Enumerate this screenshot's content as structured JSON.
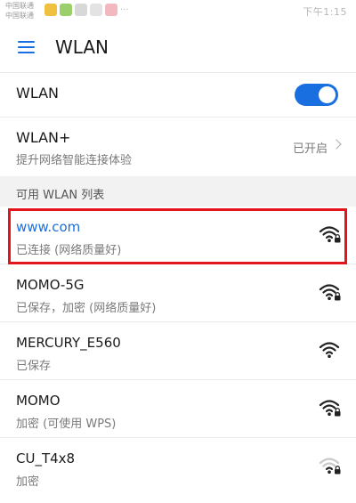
{
  "statusbar": {
    "carrier1": "中国联通",
    "carrier2": "中国联通",
    "right_text": "下午1:15"
  },
  "appbar": {
    "title": "WLAN"
  },
  "wlan": {
    "label": "WLAN",
    "enabled": true
  },
  "wlan_plus": {
    "label": "WLAN+",
    "subtitle": "提升网络智能连接体验",
    "status": "已开启"
  },
  "section": {
    "title": "可用 WLAN 列表"
  },
  "networks": [
    {
      "name": "www.com",
      "status": "已连接 (网络质量好)",
      "connected": true,
      "secured": true,
      "signal": 4
    },
    {
      "name": "MOMO-5G",
      "status": "已保存，加密 (网络质量好)",
      "connected": false,
      "secured": true,
      "signal": 4
    },
    {
      "name": "MERCURY_E560",
      "status": "已保存",
      "connected": false,
      "secured": false,
      "signal": 4
    },
    {
      "name": "MOMO",
      "status": "加密 (可使用 WPS)",
      "connected": false,
      "secured": true,
      "signal": 4
    },
    {
      "name": "CU_T4x8",
      "status": "加密",
      "connected": false,
      "secured": true,
      "signal": 2
    }
  ],
  "colors": {
    "accent": "#1a6fe0",
    "highlight": "#e3141e"
  }
}
